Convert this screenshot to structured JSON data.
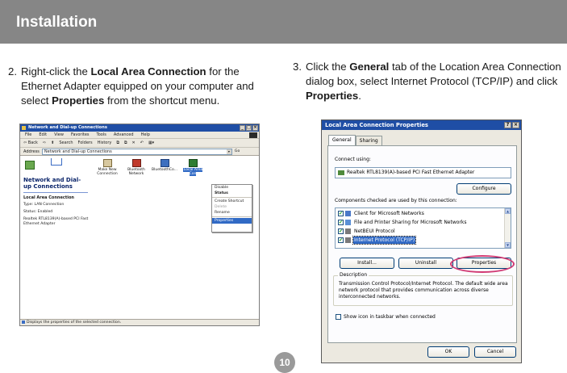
{
  "header": {
    "title": "Installation"
  },
  "step2": {
    "number": "2.",
    "t1": "Right-click the ",
    "b1": "Local Area Connection",
    "t2": " for the Ethernet Adapter equipped on your computer and select ",
    "b2": "Properties",
    "t3": " from the shortcut menu."
  },
  "step3": {
    "number": "3.",
    "t1": "Click the ",
    "b1": "General",
    "t2": " tab of the Location Area Connection dialog box, select Internet Protocol (TCP/IP) and click ",
    "b2": "Properties",
    "t3": "."
  },
  "explorer": {
    "title": "Network and Dial-up Connections",
    "window_buttons": [
      "_",
      "□",
      "×"
    ],
    "menu": [
      "File",
      "Edit",
      "View",
      "Favorites",
      "Tools",
      "Advanced",
      "Help"
    ],
    "toolbar": [
      "⇦ Back",
      "⇨",
      "⬆",
      "Search",
      "Folders",
      "History",
      "⧉",
      "⧉",
      "✕",
      "↶",
      "▦▾"
    ],
    "address_label": "Address",
    "address_value": "Network and Dial-up Connections",
    "go_label": "Go",
    "pane_title": "Network and Dial-up Connections",
    "pane_subtitle": "Local Area Connection",
    "pane_type": "Type: LAN Connection",
    "pane_status": "Status: Enabled",
    "pane_adapter": "Realtek RTL8139(A)-based PCI Fast Ethernet Adapter",
    "icons": [
      {
        "label": "Make New Connection"
      },
      {
        "label": "Bluetooth Network"
      },
      {
        "label": "BluetoothCo..."
      },
      {
        "label": "Local Area Con"
      }
    ],
    "context_menu": {
      "disable": "Disable",
      "status": "Status",
      "create_shortcut": "Create Shortcut",
      "delete": "Delete",
      "rename": "Rename",
      "properties": "Properties"
    },
    "status_bar": "Displays the properties of the selected connection."
  },
  "dialog": {
    "title": "Local Area Connection Properties",
    "window_buttons": [
      "?",
      "×"
    ],
    "tabs": [
      "General",
      "Sharing"
    ],
    "connect_using_label": "Connect using:",
    "adapter": "Realtek RTL8139(A)-based PCI Fast Ethernet Adapter",
    "configure_button": "Configure",
    "components_label": "Components checked are used by this connection:",
    "components": [
      {
        "label": "Client for Microsoft Networks",
        "checked": true
      },
      {
        "label": "File and Printer Sharing for Microsoft Networks",
        "checked": true
      },
      {
        "label": "NetBEUI Protocol",
        "checked": true
      },
      {
        "label": "Internet Protocol (TCP/IP)",
        "checked": true,
        "selected": true
      }
    ],
    "install_button": "Install...",
    "uninstall_button": "Uninstall",
    "properties_button": "Properties",
    "description_title": "Description",
    "description_text": "Transmission Control Protocol/Internet Protocol. The default wide area network protocol that provides communication across diverse interconnected networks.",
    "show_icon_label": "Show icon in taskbar when connected",
    "ok_button": "OK",
    "cancel_button": "Cancel",
    "colors": {
      "titlebar": "#1f4ea5",
      "highlight_ring": "#d13a73",
      "selection": "#316ac5"
    }
  },
  "page_number": "10"
}
